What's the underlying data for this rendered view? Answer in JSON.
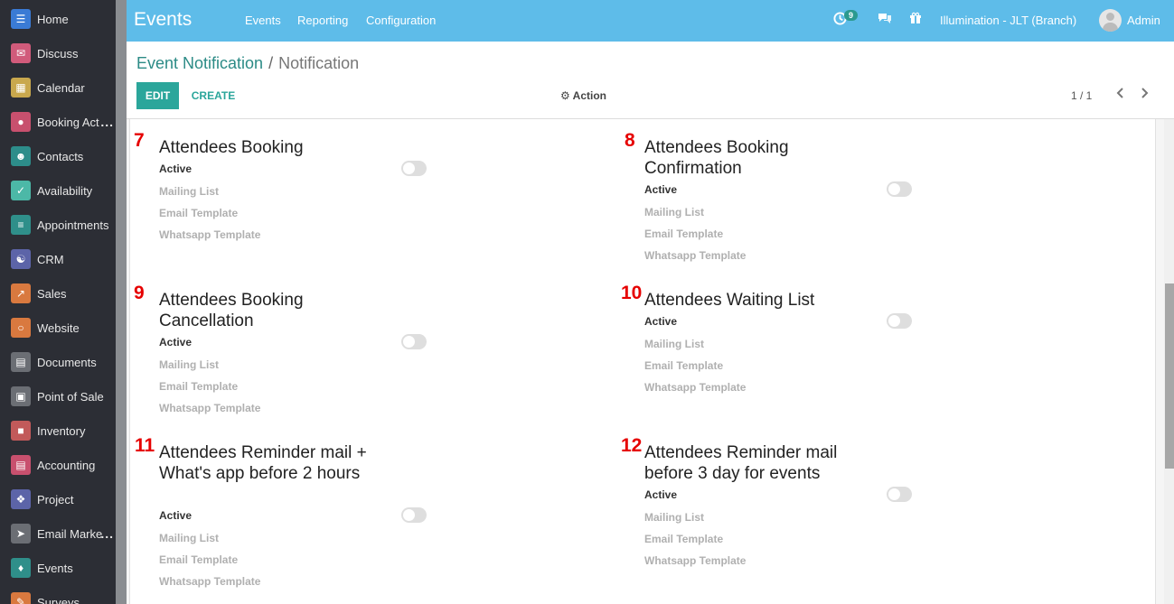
{
  "sidebar": {
    "items": [
      {
        "label": "Home",
        "icon": "home-icon",
        "color": "#3a7bd5",
        "ellipsis": ""
      },
      {
        "label": "Discuss",
        "icon": "chat-icon",
        "color": "#d15b7b",
        "ellipsis": ""
      },
      {
        "label": "Calendar",
        "icon": "calendar-icon",
        "color": "#c9a84d",
        "ellipsis": ""
      },
      {
        "label": "Booking Act",
        "icon": "booking-icon",
        "color": "#c8506e",
        "ellipsis": "..."
      },
      {
        "label": "Contacts",
        "icon": "contacts-icon",
        "color": "#2d8d8a",
        "ellipsis": ""
      },
      {
        "label": "Availability",
        "icon": "availability-icon",
        "color": "#4cb8a7",
        "ellipsis": ""
      },
      {
        "label": "Appointments",
        "icon": "appointments-icon",
        "color": "#2f8f8a",
        "ellipsis": ""
      },
      {
        "label": "CRM",
        "icon": "handshake-icon",
        "color": "#5c64a8",
        "ellipsis": ""
      },
      {
        "label": "Sales",
        "icon": "chart-icon",
        "color": "#d9793f",
        "ellipsis": ""
      },
      {
        "label": "Website",
        "icon": "globe-icon",
        "color": "#d9793f",
        "ellipsis": ""
      },
      {
        "label": "Documents",
        "icon": "documents-icon",
        "color": "#6b6e74",
        "ellipsis": ""
      },
      {
        "label": "Point of Sale",
        "icon": "pos-icon",
        "color": "#6b6e74",
        "ellipsis": ""
      },
      {
        "label": "Inventory",
        "icon": "inventory-icon",
        "color": "#c25a5a",
        "ellipsis": ""
      },
      {
        "label": "Accounting",
        "icon": "accounting-icon",
        "color": "#c8506e",
        "ellipsis": ""
      },
      {
        "label": "Project",
        "icon": "puzzle-icon",
        "color": "#5c64a8",
        "ellipsis": ""
      },
      {
        "label": "Email Marke",
        "icon": "paper-plane-icon",
        "color": "#6b6e74",
        "ellipsis": "..."
      },
      {
        "label": "Events",
        "icon": "ticket-icon",
        "color": "#2f8f8a",
        "ellipsis": ""
      },
      {
        "label": "Surveys",
        "icon": "survey-icon",
        "color": "#d9793f",
        "ellipsis": ""
      }
    ]
  },
  "topbar": {
    "app_title": "Events",
    "menu": [
      "Events",
      "Reporting",
      "Configuration"
    ],
    "activity_count": "9",
    "company": "Illumination - JLT (Branch)",
    "user": "Admin"
  },
  "control_panel": {
    "breadcrumb_parent": "Event Notification",
    "breadcrumb_sep": "/",
    "breadcrumb_current": "Notification",
    "edit_label": "EDIT",
    "create_label": "CREATE",
    "action_label": "Action",
    "pager": "1 / 1"
  },
  "labels": {
    "active": "Active",
    "mailing_list": "Mailing List",
    "email_template": "Email Template",
    "whatsapp_template": "Whatsapp Template"
  },
  "notifications": [
    {
      "number": "7",
      "title": "Attendees Booking",
      "active": false
    },
    {
      "number": "8",
      "title": "Attendees Booking Confirmation",
      "active": false
    },
    {
      "number": "9",
      "title": "Attendees Booking Cancellation",
      "active": false
    },
    {
      "number": "10",
      "title": "Attendees Waiting List",
      "active": false
    },
    {
      "number": "11",
      "title": "Attendees Reminder mail + What's app before 2 hours",
      "active": false
    },
    {
      "number": "12",
      "title": "Attendees Reminder mail before 3 day for events",
      "active": false
    }
  ]
}
